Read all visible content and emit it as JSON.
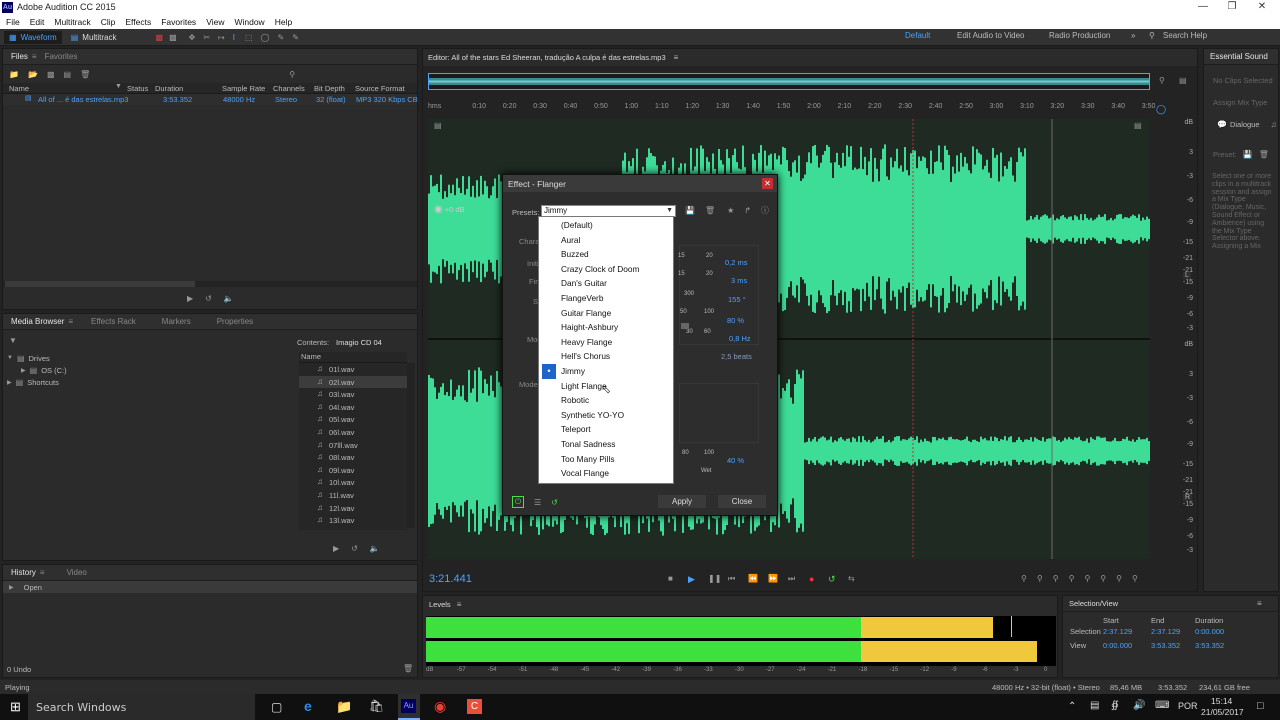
{
  "titlebar": {
    "title": "Adobe Audition CC 2015",
    "app_icon": "Au"
  },
  "menubar": {
    "items": [
      "File",
      "Edit",
      "Multitrack",
      "Clip",
      "Effects",
      "Favorites",
      "View",
      "Window",
      "Help"
    ]
  },
  "toolbar": {
    "waveform_label": "Waveform",
    "multitrack_label": "Multitrack",
    "workspaces": [
      "Default",
      "Edit Audio to Video",
      "Radio Production"
    ],
    "more": "»",
    "search_label": "Search Help"
  },
  "files": {
    "tabs": [
      "Files",
      "Favorites"
    ],
    "headers": [
      "Name",
      "Status",
      "Duration",
      "Sample Rate",
      "Channels",
      "Bit Depth",
      "Source Format"
    ],
    "row": {
      "name": "All of ... é das estrelas.mp3",
      "duration": "3:53.352",
      "rate": "48000 Hz",
      "channels": "Stereo",
      "depth": "32 (float)",
      "format": "MP3 320 Kbps CB"
    }
  },
  "media": {
    "tabs": [
      "Media Browser",
      "Effects Rack",
      "Markers",
      "Properties"
    ],
    "contents_label": "Contents:",
    "contents_value": "Imagio CD 04",
    "tree": [
      "Drives",
      "OS (C:)",
      "Shortcuts"
    ],
    "name_header": "Name",
    "files": [
      "01l.wav",
      "02l.wav",
      "03l.wav",
      "04l.wav",
      "05l.wav",
      "06l.wav",
      "07lll.wav",
      "08l.wav",
      "09l.wav",
      "10l.wav",
      "11l.wav",
      "12l.wav",
      "13l.wav"
    ]
  },
  "history": {
    "tabs": [
      "History",
      "Video"
    ],
    "item": "Open",
    "undo": "0 Undo"
  },
  "editor": {
    "title": "Editor: All of the stars Ed Sheeran, tradução A culpa é das estrelas.mp3",
    "ruler_unit": "hms",
    "ruler": [
      "0:10",
      "0:20",
      "0:30",
      "0:40",
      "0:50",
      "1:00",
      "1:10",
      "1:20",
      "1:30",
      "1:40",
      "1:50",
      "2:00",
      "2:10",
      "2:20",
      "2:30",
      "2:40",
      "2:50",
      "3:00",
      "3:10",
      "3:20",
      "3:30",
      "3:40",
      "3:50"
    ],
    "db_scale": [
      "dB",
      "3",
      "-3",
      "-6",
      "-9",
      "-15",
      "-21",
      "-21",
      "-15",
      "-9",
      "-6",
      "-3"
    ],
    "channel_labels": [
      "L",
      "R"
    ],
    "time": "3:21.441",
    "gain": "+0 dB"
  },
  "essential": {
    "title": "Essential Sound",
    "no_clips": "No Clips Selected",
    "assign": "Assign Mix Type",
    "dialogue": "Dialogue",
    "preset": "Preset:",
    "help": "Select one or more clips in a multitrack session and assign a Mix Type (Dialogue, Music, Sound Effect or Ambience) using the Mix Type Selector above. Assigning a Mix"
  },
  "dialog": {
    "title": "Effect - Flanger",
    "presets_label": "Presets:",
    "preset_value": "Jimmy",
    "bg_labels": [
      "Chara",
      "Initi",
      "Fina",
      "St",
      "Mod",
      "Mode"
    ],
    "values": [
      "0,2 ms",
      "3 ms",
      "155 °",
      "80 %",
      "0,8 Hz",
      "2,5 beats",
      "40 %"
    ],
    "ticks": [
      "15",
      "20",
      "15",
      "20",
      "300",
      "50",
      "100",
      "30",
      "60",
      "80",
      "100"
    ],
    "wet_label": "Wet",
    "apply": "Apply",
    "close": "Close"
  },
  "presets_menu": {
    "items": [
      "(Default)",
      "Aural",
      "Buzzed",
      "Crazy Clock of Doom",
      "Dan's Guitar",
      "FlangeVerb",
      "Guitar Flange",
      "Haight-Ashbury",
      "Heavy Flange",
      "Hell's Chorus",
      "Jimmy",
      "Light Flange",
      "Robotic",
      "Synthetic YO-YO",
      "Teleport",
      "Tonal Sadness",
      "Too Many Pills",
      "Vocal Flange"
    ],
    "selected": "Jimmy"
  },
  "levels": {
    "title": "Levels",
    "left_level": 0.9,
    "right_level": 0.97,
    "scale": [
      "dB",
      "-57",
      "-54",
      "-51",
      "-48",
      "-45",
      "-42",
      "-39",
      "-36",
      "-33",
      "-30",
      "-27",
      "-24",
      "-21",
      "-18",
      "-15",
      "-12",
      "-9",
      "-6",
      "-3",
      "0"
    ]
  },
  "selection": {
    "title": "Selection/View",
    "headers": [
      "Start",
      "End",
      "Duration"
    ],
    "rows": [
      {
        "label": "Selection",
        "start": "2:37.129",
        "end": "2:37.129",
        "duration": "0:00.000"
      },
      {
        "label": "View",
        "start": "0:00.000",
        "end": "3:53.352",
        "duration": "3:53.352"
      }
    ]
  },
  "statusbar": {
    "left": "Playing",
    "info": [
      "48000 Hz • 32-bit (float) • Stereo",
      "85,46 MB",
      "3:53.352",
      "234,61 GB free"
    ]
  },
  "taskbar": {
    "search": "Search Windows",
    "lang": "POR",
    "time": "15:14",
    "date": "21/05/2017"
  },
  "colors": {
    "accent": "#4aa3ff",
    "waveform": "#3ddc97",
    "meter_green": "#3de03d",
    "meter_yellow": "#f0c83c",
    "record": "#e23b3b"
  }
}
